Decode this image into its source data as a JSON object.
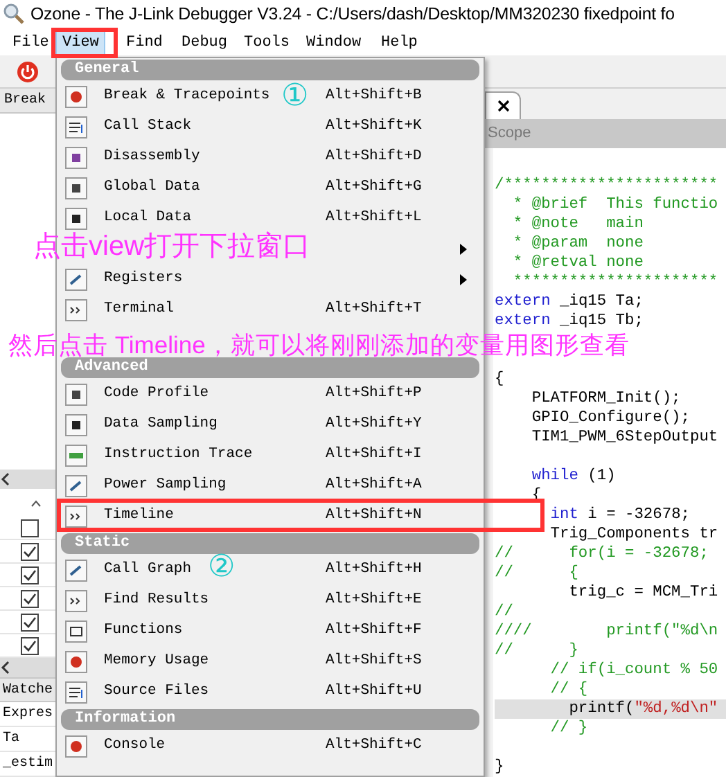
{
  "window": {
    "title": "Ozone - The J-Link Debugger V3.24 - C:/Users/dash/Desktop/MM320230 fixedpoint fo"
  },
  "menu_bar": [
    {
      "label": "File",
      "selected": false
    },
    {
      "label": "View",
      "selected": true
    },
    {
      "label": "Find",
      "selected": false
    },
    {
      "label": "Debug",
      "selected": false
    },
    {
      "label": "Tools",
      "selected": false
    },
    {
      "label": "Window",
      "selected": false
    },
    {
      "label": "Help",
      "selected": false
    }
  ],
  "left_panel": {
    "header": "Break",
    "checkboxes": [
      {
        "checked": false
      },
      {
        "checked": true
      },
      {
        "checked": true
      },
      {
        "checked": true
      },
      {
        "checked": true
      },
      {
        "checked": true
      }
    ],
    "watch_header": "Watche",
    "watch_rows": [
      "Expres",
      "Ta",
      "_estim"
    ]
  },
  "editor": {
    "column_header": "Scope",
    "lines": [
      {
        "kind": "text",
        "tokens": [
          {
            "kind": "comment",
            "text": "/***********************"
          }
        ]
      },
      {
        "kind": "text",
        "tokens": [
          {
            "kind": "comment",
            "text": "  * @brief  This functio"
          }
        ]
      },
      {
        "kind": "text",
        "tokens": [
          {
            "kind": "comment",
            "text": "  * @note   main"
          }
        ]
      },
      {
        "kind": "text",
        "tokens": [
          {
            "kind": "comment",
            "text": "  * @param  none"
          }
        ]
      },
      {
        "kind": "text",
        "tokens": [
          {
            "kind": "comment",
            "text": "  * @retval none"
          }
        ]
      },
      {
        "kind": "text",
        "tokens": [
          {
            "kind": "comment",
            "text": "  **********************"
          }
        ]
      },
      {
        "kind": "text",
        "tokens": [
          {
            "kind": "keyword",
            "text": "extern"
          },
          {
            "kind": "plain",
            "text": " _iq15 Ta;"
          }
        ]
      },
      {
        "kind": "text",
        "tokens": [
          {
            "kind": "keyword",
            "text": "extern"
          },
          {
            "kind": "plain",
            "text": " _iq15 Tb;"
          }
        ]
      },
      {
        "kind": "blank"
      },
      {
        "kind": "blank"
      },
      {
        "kind": "text",
        "tokens": [
          {
            "kind": "plain",
            "text": "{"
          }
        ]
      },
      {
        "kind": "text",
        "tokens": [
          {
            "kind": "plain",
            "text": "    PLATFORM_Init();"
          }
        ]
      },
      {
        "kind": "text",
        "tokens": [
          {
            "kind": "plain",
            "text": "    GPIO_Configure();"
          }
        ]
      },
      {
        "kind": "text",
        "tokens": [
          {
            "kind": "plain",
            "text": "    TIM1_PWM_6StepOutput"
          }
        ]
      },
      {
        "kind": "blank"
      },
      {
        "kind": "text",
        "tokens": [
          {
            "kind": "keyword",
            "text": "    while"
          },
          {
            "kind": "plain",
            "text": " (1)"
          }
        ]
      },
      {
        "kind": "text",
        "tokens": [
          {
            "kind": "plain",
            "text": "    {"
          }
        ]
      },
      {
        "kind": "text",
        "tokens": [
          {
            "kind": "keyword",
            "text": "      int"
          },
          {
            "kind": "plain",
            "text": " i = -32678;"
          }
        ]
      },
      {
        "kind": "text",
        "tokens": [
          {
            "kind": "plain",
            "text": "      Trig_Components tr"
          }
        ]
      },
      {
        "kind": "text",
        "tokens": [
          {
            "kind": "comment",
            "text": "//      for(i = -32678;"
          }
        ]
      },
      {
        "kind": "text",
        "tokens": [
          {
            "kind": "comment",
            "text": "//      {"
          }
        ]
      },
      {
        "kind": "text",
        "tokens": [
          {
            "kind": "plain",
            "text": "        trig_c = MCM_Tri"
          }
        ]
      },
      {
        "kind": "text",
        "tokens": [
          {
            "kind": "comment",
            "text": "//"
          }
        ]
      },
      {
        "kind": "text",
        "tokens": [
          {
            "kind": "comment",
            "text": "////        printf(\"%d\\n"
          }
        ]
      },
      {
        "kind": "text",
        "tokens": [
          {
            "kind": "comment",
            "text": "//      }"
          }
        ]
      },
      {
        "kind": "text",
        "tokens": [
          {
            "kind": "comment",
            "text": "      // if(i_count % 50"
          }
        ]
      },
      {
        "kind": "text",
        "tokens": [
          {
            "kind": "comment",
            "text": "      // {"
          }
        ]
      },
      {
        "kind": "text",
        "highlighted": true,
        "tokens": [
          {
            "kind": "plain",
            "text": "        printf("
          },
          {
            "kind": "string",
            "text": "\"%d,%d\\n\""
          }
        ]
      },
      {
        "kind": "text",
        "tokens": [
          {
            "kind": "comment",
            "text": "      // }"
          }
        ]
      },
      {
        "kind": "blank"
      },
      {
        "kind": "text",
        "tokens": [
          {
            "kind": "plain",
            "text": "}"
          }
        ]
      }
    ]
  },
  "view_menu": {
    "sections": [
      {
        "title": "General",
        "items": [
          {
            "label": "Break & Tracepoints",
            "shortcut": "Alt+Shift+B",
            "submenu": false
          },
          {
            "label": "Call Stack",
            "shortcut": "Alt+Shift+K",
            "submenu": false
          },
          {
            "label": "Disassembly",
            "shortcut": "Alt+Shift+D",
            "submenu": false
          },
          {
            "label": "Global Data",
            "shortcut": "Alt+Shift+G",
            "submenu": false
          },
          {
            "label": "Local Data",
            "shortcut": "Alt+Shift+L",
            "submenu": false
          },
          {
            "submenu": true
          },
          {
            "label": "Registers",
            "submenu": true
          },
          {
            "label": "Terminal",
            "shortcut": "Alt+Shift+T",
            "submenu": false
          }
        ]
      },
      {
        "title": "Advanced",
        "items": [
          {
            "label": "Code Profile",
            "shortcut": "Alt+Shift+P",
            "submenu": false
          },
          {
            "label": "Data Sampling",
            "shortcut": "Alt+Shift+Y",
            "submenu": false
          },
          {
            "label": "Instruction Trace",
            "shortcut": "Alt+Shift+I",
            "submenu": false
          },
          {
            "label": "Power Sampling",
            "shortcut": "Alt+Shift+A",
            "submenu": false
          },
          {
            "label": "Timeline",
            "shortcut": "Alt+Shift+N",
            "submenu": false
          }
        ]
      },
      {
        "title": "Static",
        "items": [
          {
            "label": "Call Graph",
            "shortcut": "Alt+Shift+H",
            "submenu": false
          },
          {
            "label": "Find Results",
            "shortcut": "Alt+Shift+E",
            "submenu": false
          },
          {
            "label": "Functions",
            "shortcut": "Alt+Shift+F",
            "submenu": false
          },
          {
            "label": "Memory Usage",
            "shortcut": "Alt+Shift+S",
            "submenu": false
          },
          {
            "label": "Source Files",
            "shortcut": "Alt+Shift+U",
            "submenu": false
          }
        ]
      },
      {
        "title": "Information",
        "items": [
          {
            "label": "Console",
            "shortcut": "Alt+Shift+C",
            "submenu": false
          }
        ]
      }
    ]
  },
  "annotations": [
    {
      "kind": "box"
    },
    {
      "kind": "box"
    },
    {
      "kind": "note",
      "text": "点击view打开下拉窗口"
    },
    {
      "kind": "note",
      "text": "然后点击 Timeline，就可以将刚刚添加的变量用图形查看"
    },
    {
      "kind": "step",
      "text": "①"
    },
    {
      "kind": "step",
      "text": "②"
    }
  ]
}
